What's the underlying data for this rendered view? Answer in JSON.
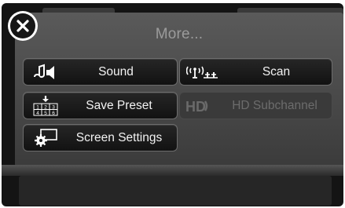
{
  "title": "More...",
  "buttons": {
    "sound": "Sound",
    "scan": "Scan",
    "save_preset": "Save Preset",
    "hd_subchannel": "HD Subchannel",
    "screen_settings": "Screen Settings"
  },
  "preset_numbers": [
    "1",
    "2",
    "3",
    "4",
    "5",
    "6"
  ],
  "hd_badge": "HD"
}
